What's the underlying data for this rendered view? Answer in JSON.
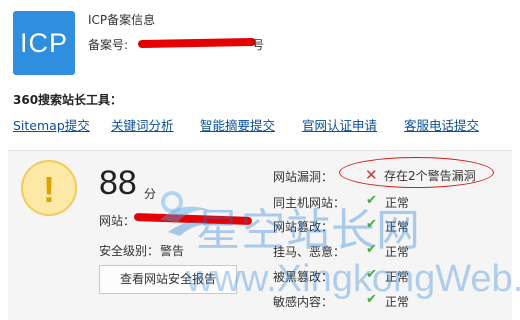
{
  "icp": {
    "logo_text": "ICP",
    "title": "ICP备案信息",
    "number_label": "备案号:",
    "number_tail": "号"
  },
  "tools": {
    "title": "360搜索站长工具：",
    "links": [
      "Sitemap提交",
      "关键词分析",
      "智能摘要提交",
      "官网认证申请",
      "客服电话提交"
    ]
  },
  "security": {
    "warning_symbol": "!",
    "score": "88",
    "score_unit": "分",
    "website_label": "网站：",
    "level_label": "安全级别：",
    "level_value": "警告",
    "report_button": "查看网站安全报告",
    "checks": [
      {
        "label": "网站漏洞：",
        "status": "warning",
        "value": "存在2个警告漏洞"
      },
      {
        "label": "同主机网站：",
        "status": "ok",
        "value": "正常"
      },
      {
        "label": "网站篡改：",
        "status": "ok",
        "value": "正常"
      },
      {
        "label": "挂马、恶意：",
        "status": "ok",
        "value": "正常"
      },
      {
        "label": "被黑篡改：",
        "status": "ok",
        "value": "正常"
      },
      {
        "label": "敏感内容：",
        "status": "ok",
        "value": "正常"
      }
    ]
  },
  "watermark": {
    "text": "星空站长网",
    "url": "www.XingkongWeb.com"
  },
  "colors": {
    "icp_blue": "#2f8ee0",
    "link_blue": "#0b4f9c",
    "ok_green": "#3fae3a",
    "alert_red": "#d21e1e"
  }
}
